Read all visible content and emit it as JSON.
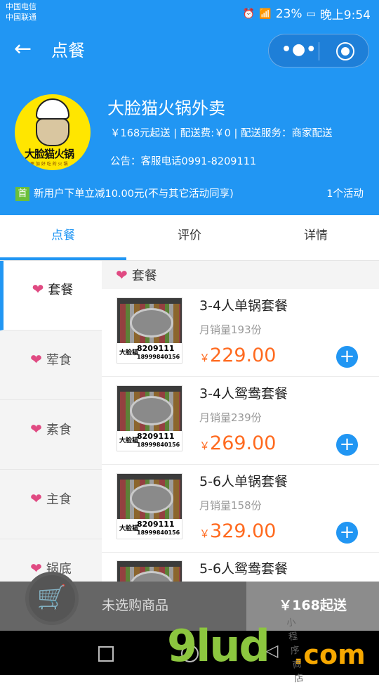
{
  "status_bar": {
    "carrier_1": "中国电信",
    "carrier_2": "中国联通",
    "battery": "23%",
    "time": "晚上9:54"
  },
  "nav": {
    "title": "点餐",
    "back_icon": "back-arrow-icon",
    "more_icon": "more-dots-icon",
    "close_icon": "target-close-icon"
  },
  "shop": {
    "name": "大脸猫火锅外卖",
    "logo_text": "大脸猫火锅",
    "logo_subtext": "更 加 好 吃 的 火 锅",
    "meta": "￥168元起送 | 配送费:￥0 | 配送服务：商家配送",
    "notice": "公告：客服电话0991-8209111",
    "promo_badge": "首",
    "promo_text": "新用户下单立减10.00元(不与其它活动同享)",
    "activity_count": "1个活动"
  },
  "tabs": [
    {
      "label": "点餐",
      "active": true
    },
    {
      "label": "评价",
      "active": false
    },
    {
      "label": "详情",
      "active": false
    }
  ],
  "categories": [
    {
      "label": "套餐",
      "active": true
    },
    {
      "label": "荤食",
      "active": false
    },
    {
      "label": "素食",
      "active": false
    },
    {
      "label": "主食",
      "active": false
    },
    {
      "label": "锅底",
      "active": false
    }
  ],
  "section_title": "套餐",
  "items": [
    {
      "name": "3-4人单锅套餐",
      "sales": "月销量193份",
      "currency": "￥",
      "price": "229.00",
      "phone1": "8209111",
      "phone2": "18999840156",
      "brand": "大脸猫"
    },
    {
      "name": "3-4人鸳鸯套餐",
      "sales": "月销量239份",
      "currency": "￥",
      "price": "269.00",
      "phone1": "8209111",
      "phone2": "18999840156",
      "brand": "大脸猫"
    },
    {
      "name": "5-6人单锅套餐",
      "sales": "月销量158份",
      "currency": "￥",
      "price": "329.00",
      "phone1": "8209111",
      "phone2": "18999840156",
      "brand": "大脸猫"
    },
    {
      "name": "5-6人鸳鸯套餐",
      "sales": "",
      "currency": "",
      "price": "",
      "phone1": "",
      "phone2": "",
      "brand": ""
    }
  ],
  "cart": {
    "empty_label": "未选购商品",
    "min_order": "￥168起送",
    "icon": "cart-icon"
  },
  "watermark": {
    "main": "9lud",
    "domain": ".com",
    "cn": "小程序商店"
  },
  "colors": {
    "primary": "#2196f3",
    "price": "#ff6a1f",
    "heart": "#e04a82",
    "promo_badge": "#6cbf3a"
  }
}
